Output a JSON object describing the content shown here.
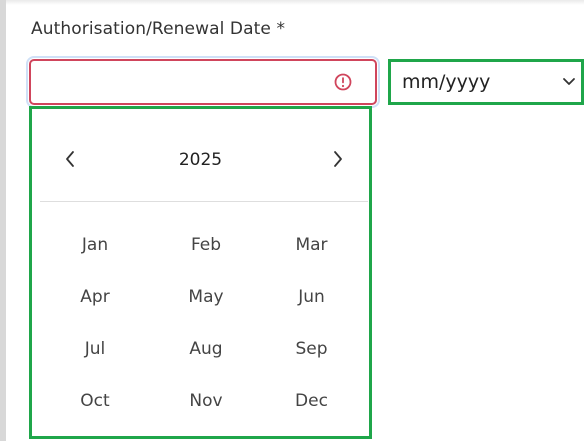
{
  "field": {
    "label": "Authorisation/Renewal Date *",
    "value": "",
    "error_icon": "exclamation-circle-icon"
  },
  "format_select": {
    "value": "mm/yyyy",
    "icon": "chevron-down-icon"
  },
  "picker": {
    "year": "2025",
    "prev_icon": "chevron-left-icon",
    "next_icon": "chevron-right-icon",
    "months": [
      "Jan",
      "Feb",
      "Mar",
      "Apr",
      "May",
      "Jun",
      "Jul",
      "Aug",
      "Sep",
      "Oct",
      "Nov",
      "Dec"
    ]
  },
  "colors": {
    "error": "#d0455c",
    "highlight": "#1fa64a",
    "focus": "#cfe0f7"
  }
}
